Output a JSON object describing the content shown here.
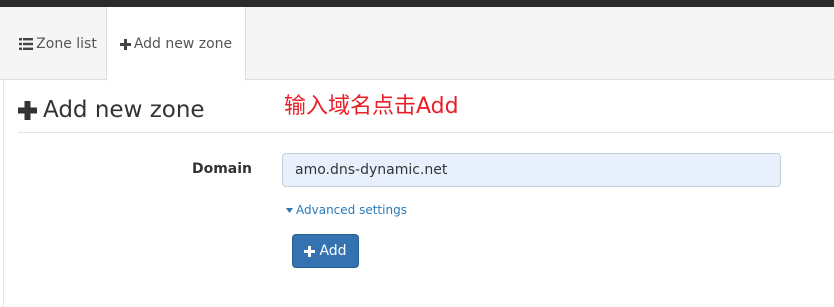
{
  "tabs": [
    {
      "label": "Zone list",
      "icon": "list-icon"
    },
    {
      "label": "Add new zone",
      "icon": "plus-icon"
    }
  ],
  "panel": {
    "title": "Add new zone",
    "annotation": "输入域名点击Add"
  },
  "form": {
    "domain_label": "Domain",
    "domain_value": "amo.dns-dynamic.net",
    "advanced_label": "Advanced settings",
    "submit_label": "Add"
  },
  "colors": {
    "primary_button": "#3572b0",
    "link": "#2a7ab8",
    "annotation": "#e8202a",
    "input_fill": "#e8f0fe"
  }
}
